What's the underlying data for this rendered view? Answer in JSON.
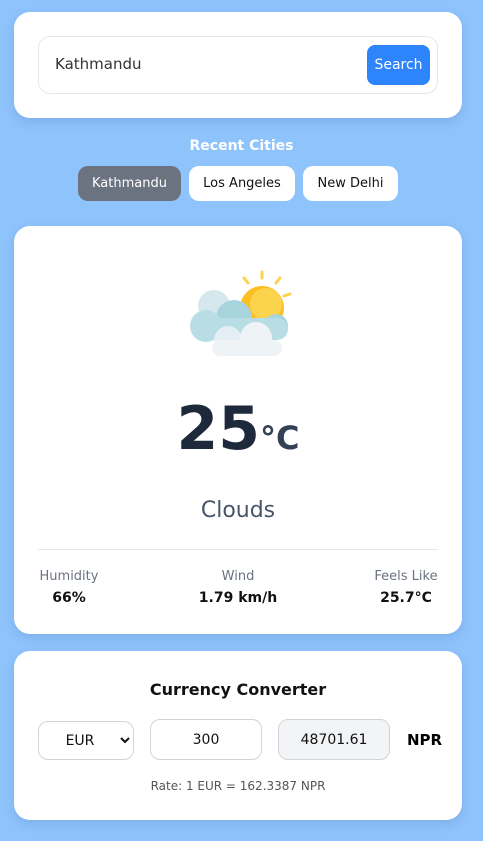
{
  "search": {
    "value": "Kathmandu",
    "button": "Search"
  },
  "recent": {
    "title": "Recent Cities",
    "cities": [
      "Kathmandu",
      "Los Angeles",
      "New Delhi"
    ],
    "active": "Kathmandu"
  },
  "weather": {
    "icon": "sun-behind-clouds-icon",
    "temp": "25",
    "unit": "°C",
    "condition": "Clouds",
    "stats": [
      {
        "label": "Humidity",
        "value": "66%"
      },
      {
        "label": "Wind",
        "value": "1.79 km/h"
      },
      {
        "label": "Feels Like",
        "value": "25.7°C"
      }
    ]
  },
  "currency": {
    "title": "Currency Converter",
    "from": "EUR",
    "amount": "300",
    "result": "48701.61",
    "to": "NPR",
    "rate": "Rate: 1 EUR = 162.3387 NPR"
  },
  "colors": {
    "background": "#8fc3fc",
    "accent": "#2d84fb",
    "active_chip": "#6b7280"
  }
}
